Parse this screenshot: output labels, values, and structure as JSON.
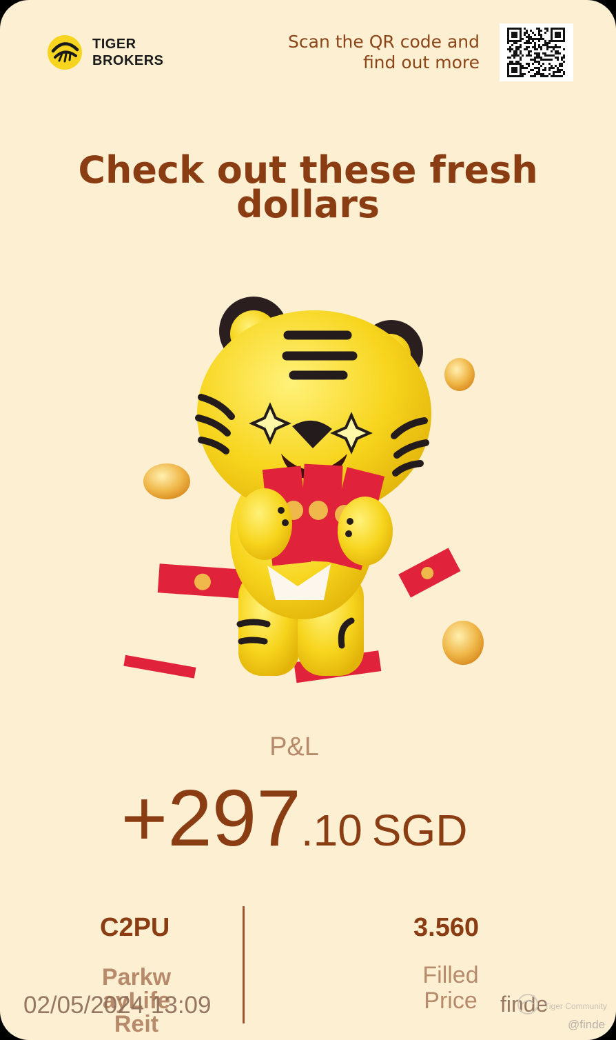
{
  "brand": {
    "logo_icon": "tiger-logo-icon",
    "line1": "TIGER",
    "line2": "BROKERS"
  },
  "qr": {
    "caption_line1": "Scan the QR code and",
    "caption_line2": "find out more",
    "icon": "qr-code-icon"
  },
  "headline": {
    "line1": "Check out these fresh",
    "line2": "dollars"
  },
  "illustration": {
    "icon": "tiger-mascot-with-red-packets"
  },
  "pnl": {
    "label": "P&L",
    "value_main": "+297",
    "value_decimal": ".10",
    "currency": "SGD"
  },
  "position": {
    "symbol": "C2PU",
    "company_line1": "Parkw",
    "company_line2": "ayLife",
    "company_line3": "Reit"
  },
  "price": {
    "value": "3.560",
    "label_line1": "Filled",
    "label_line2": "Price"
  },
  "footer": {
    "timestamp": "02/05/2024 13:09",
    "watermark_user": "finde",
    "watermark_brand": "Tiger Community",
    "watermark_handle": "@finde"
  },
  "colors": {
    "background": "#fdf0d2",
    "accent_brown": "#8a3d12",
    "muted_brown": "#b68a6a",
    "tiger_yellow": "#f7d51e",
    "packet_red": "#e0223a"
  }
}
